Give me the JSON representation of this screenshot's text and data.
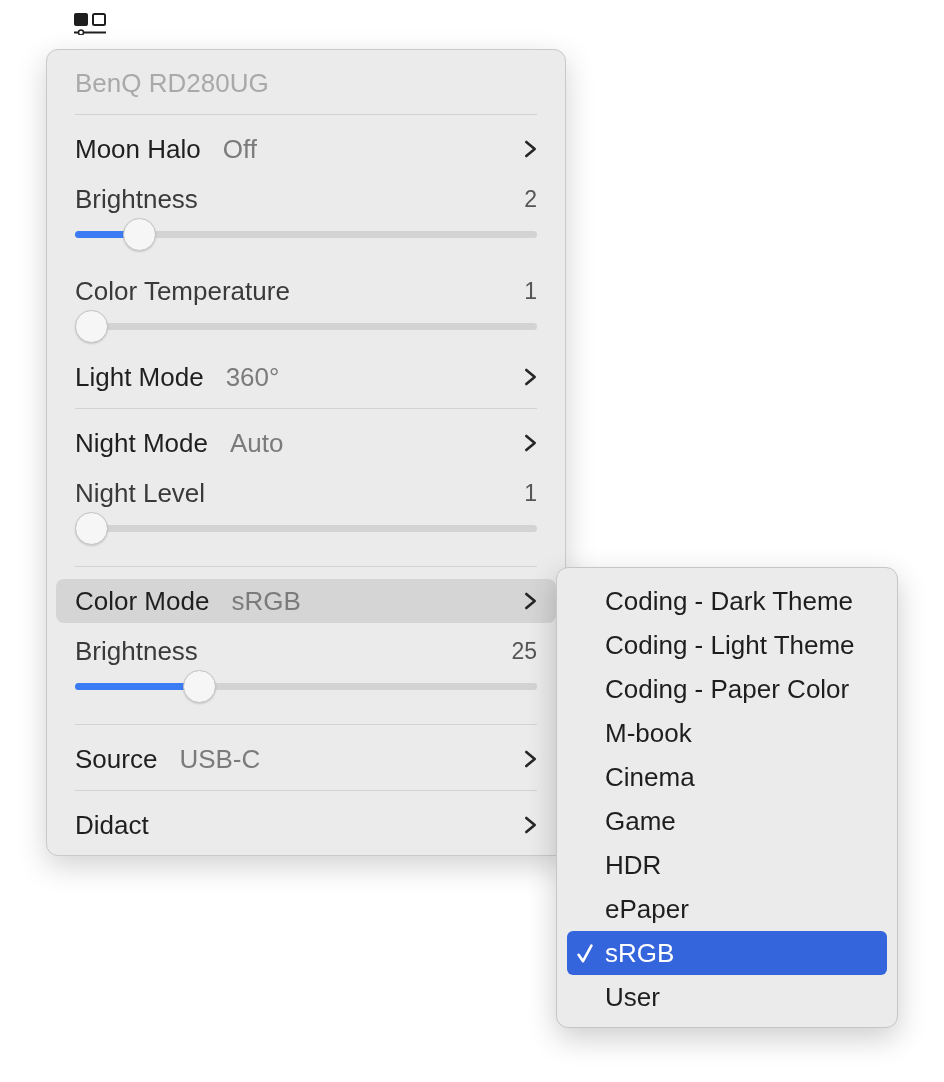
{
  "menu": {
    "title": "BenQ RD280UG",
    "sections": [
      {
        "items": [
          {
            "kind": "submenu",
            "label": "Moon Halo",
            "value": "Off",
            "highlighted": false
          },
          {
            "kind": "slider",
            "label": "Brightness",
            "reading": "2",
            "level": 0.14
          },
          {
            "kind": "slider",
            "label": "Color Temperature",
            "reading": "1",
            "level": 0
          },
          {
            "kind": "submenu",
            "label": "Light Mode",
            "value": "360°",
            "highlighted": false
          }
        ]
      },
      {
        "items": [
          {
            "kind": "submenu",
            "label": "Night Mode",
            "value": "Auto",
            "highlighted": false
          },
          {
            "kind": "slider",
            "label": "Night Level",
            "reading": "1",
            "level": 0
          }
        ]
      },
      {
        "items": [
          {
            "kind": "submenu",
            "label": "Color Mode",
            "value": "sRGB",
            "highlighted": true
          },
          {
            "kind": "slider",
            "label": "Brightness",
            "reading": "25",
            "level": 0.27
          }
        ]
      },
      {
        "items": [
          {
            "kind": "submenu",
            "label": "Source",
            "value": "USB-C",
            "highlighted": false
          }
        ]
      },
      {
        "items": [
          {
            "kind": "submenu",
            "label": "Didact",
            "highlighted": false
          }
        ]
      }
    ]
  },
  "submenu": {
    "items": [
      {
        "label": "Coding - Dark Theme",
        "selected": false
      },
      {
        "label": "Coding - Light Theme",
        "selected": false
      },
      {
        "label": "Coding - Paper Color",
        "selected": false
      },
      {
        "label": "M-book",
        "selected": false
      },
      {
        "label": "Cinema",
        "selected": false
      },
      {
        "label": "Game",
        "selected": false
      },
      {
        "label": "HDR",
        "selected": false
      },
      {
        "label": "ePaper",
        "selected": false
      },
      {
        "label": "sRGB",
        "selected": true
      },
      {
        "label": "User",
        "selected": false
      }
    ]
  }
}
